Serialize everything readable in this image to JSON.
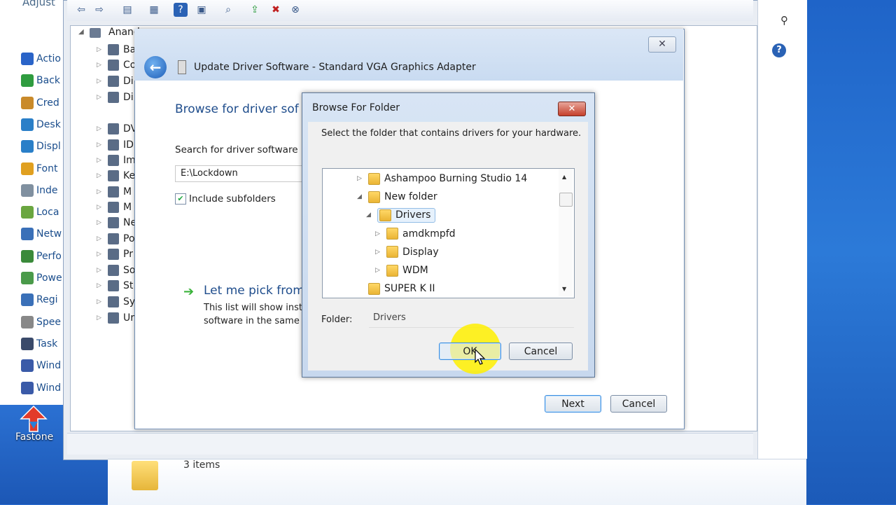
{
  "control_panel": {
    "title_partial": "Adjust",
    "items": [
      {
        "label": "Actio",
        "color": "#2a64c8"
      },
      {
        "label": "Back",
        "color": "#2f9c3f"
      },
      {
        "label": "Cred",
        "color": "#c98a2a"
      },
      {
        "label": "Desk",
        "color": "#2a7fc8"
      },
      {
        "label": "Displ",
        "color": "#2a7fc8"
      },
      {
        "label": "Font",
        "color": "#e0a020"
      },
      {
        "label": "Inde",
        "color": "#8090a0"
      },
      {
        "label": "Loca",
        "color": "#6aa640"
      },
      {
        "label": "Netw",
        "color": "#3a70b8"
      },
      {
        "label": "Perfo",
        "color": "#3a8a3a"
      },
      {
        "label": "Powe",
        "color": "#4a9a4a"
      },
      {
        "label": "Regi",
        "color": "#3a70b8"
      },
      {
        "label": "Spee",
        "color": "#888888"
      },
      {
        "label": "Task",
        "color": "#3a4a6a"
      },
      {
        "label": "Wind",
        "color": "#3a5aa8"
      },
      {
        "label": "Wind",
        "color": "#3a5aa8"
      }
    ]
  },
  "device_manager": {
    "root_label": "Anand",
    "tree": [
      {
        "label": "Ba"
      },
      {
        "label": "Co"
      },
      {
        "label": "Di"
      },
      {
        "label": "Di"
      },
      {
        "label": "DV"
      },
      {
        "label": "ID"
      },
      {
        "label": "Im"
      },
      {
        "label": "Ke"
      },
      {
        "label": "M"
      },
      {
        "label": "M"
      },
      {
        "label": "Ne"
      },
      {
        "label": "Po"
      },
      {
        "label": "Pr"
      },
      {
        "label": "So"
      },
      {
        "label": "St"
      },
      {
        "label": "Sy"
      },
      {
        "label": "Ur"
      }
    ]
  },
  "update_driver": {
    "title": "Update Driver Software - Standard VGA Graphics Adapter",
    "close_glyph": "✕",
    "heading": "Browse for driver sof",
    "search_label": "Search for driver software i",
    "path_value": "E:\\Lockdown",
    "include_subfolders": "Include subfolders",
    "include_checked": true,
    "pick_heading": "Let me pick from",
    "pick_desc_line1": "This list will show inst",
    "pick_desc_line2": "software in the same",
    "next_button": "Next",
    "cancel_button": "Cancel"
  },
  "browse_folder": {
    "title": "Browse For Folder",
    "close_glyph": "✕",
    "prompt": "Select the folder that contains drivers for your hardware.",
    "tree": [
      {
        "label": "Ashampoo Burning Studio 14",
        "toggle": "▷",
        "indent": 0
      },
      {
        "label": "New folder",
        "toggle": "◢",
        "indent": 0
      },
      {
        "label": "Drivers",
        "toggle": "◢",
        "indent": 1,
        "selected": true
      },
      {
        "label": "amdkmpfd",
        "toggle": "▷",
        "indent": 2
      },
      {
        "label": "Display",
        "toggle": "▷",
        "indent": 2
      },
      {
        "label": "WDM",
        "toggle": "▷",
        "indent": 2
      },
      {
        "label": "SUPER K II",
        "toggle": "",
        "indent": 0
      }
    ],
    "folder_label": "Folder:",
    "folder_value": "Drivers",
    "ok_button": "OK",
    "cancel_button": "Cancel"
  },
  "desktop": {
    "fastone_label": "Fastone"
  },
  "explorer_footer": {
    "items_count": "3 items"
  },
  "icons": {
    "search": "⚲",
    "help": "?",
    "back": "←"
  }
}
